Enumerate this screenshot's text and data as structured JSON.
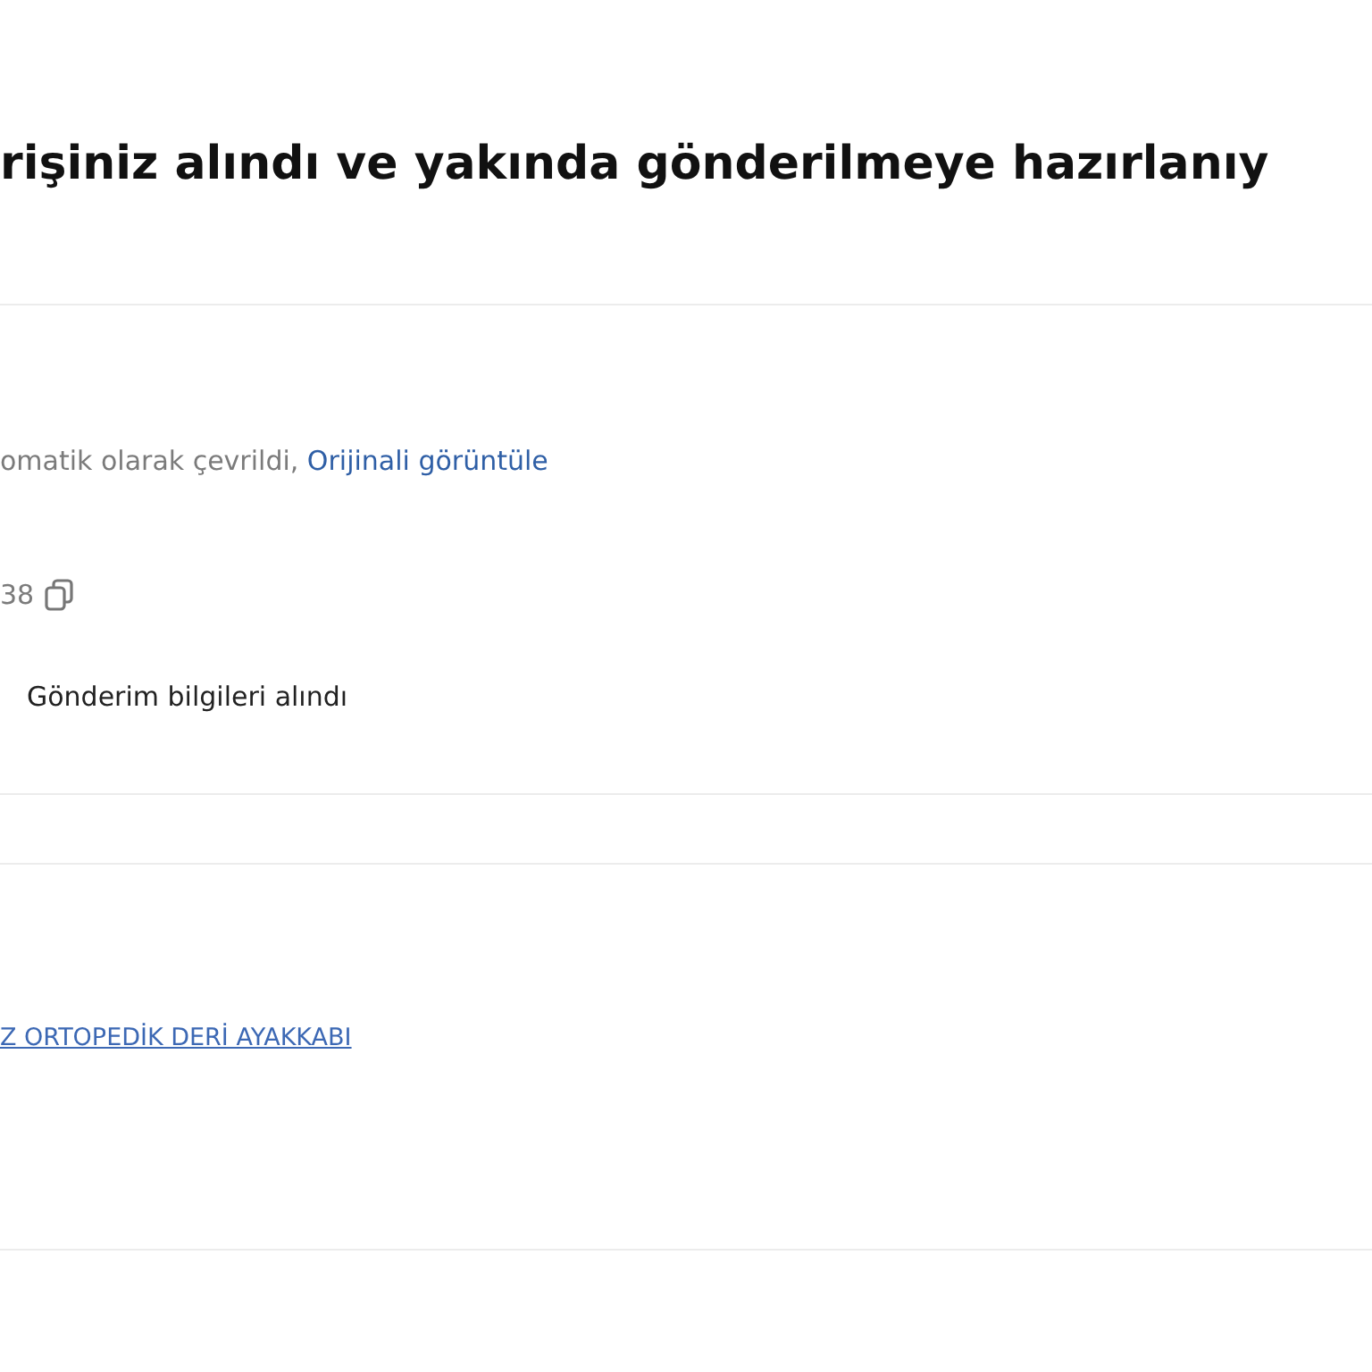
{
  "header": {
    "title": "rişiniz alındı ve yakında gönderilmeye hazırlanıy"
  },
  "order_info": {
    "translation_note": "omatik olarak çevrildi, ",
    "original_link": "Orijinali görüntüle",
    "order_number": "38",
    "status": "Gönderim bilgileri alındı"
  },
  "product": {
    "name_link": "Z ORTOPEDİK DERİ AYAKKABI"
  }
}
